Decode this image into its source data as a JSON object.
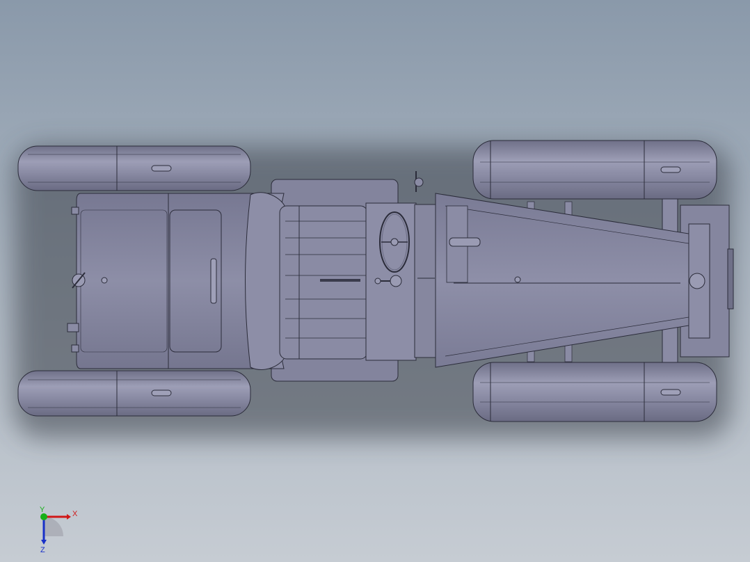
{
  "viewport": {
    "background_top": "#8a99aa",
    "background_bottom": "#c6ccd3",
    "model_color": "#7e7f98",
    "model_edge_color": "#2b2c3a"
  },
  "model": {
    "description_icon": "car-chassis-top-view"
  },
  "triad": {
    "x_label": "X",
    "y_label": "Y",
    "z_label": "Z",
    "x_color": "#d01818",
    "y_color": "#18b018",
    "z_color": "#1830c8"
  }
}
